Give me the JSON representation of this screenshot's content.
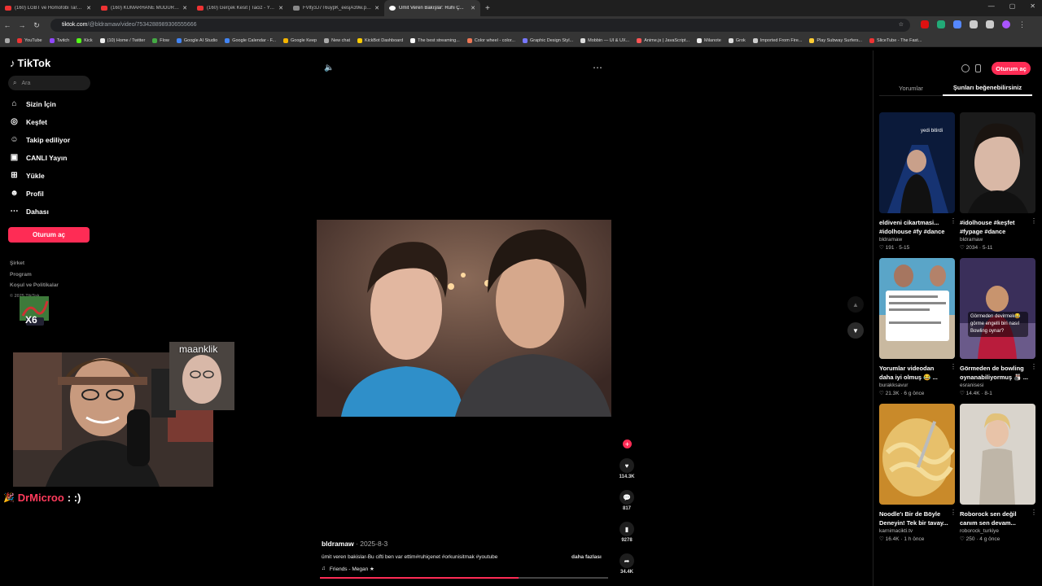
{
  "browser": {
    "tabs": [
      {
        "title": "(160) LGBT ve Homofobi Tartış...",
        "favicon": "youtube-icon"
      },
      {
        "title": "(160) KUMARHANE MÜDÜRÜ...",
        "favicon": "youtube-icon"
      },
      {
        "title": "(160) Gerçek Kesit | Taciz - You...",
        "favicon": "youtube-icon"
      },
      {
        "title": "FVlty3J7T6uypK_eesjA39w.png",
        "favicon": "image-icon"
      },
      {
        "title": "Ümit Veren Bakışlar: Ruhi Ç...",
        "favicon": "tiktok-icon",
        "active": true
      }
    ],
    "new_tab": "+",
    "url_host": "tiktok.com",
    "url_path": "/@bldramaw/video/7534288989306555666",
    "bookmarks": [
      "YouTube",
      "Twitch",
      "Kick",
      "(10) Home / Twitter",
      "Flow",
      "Google AI Studio",
      "Google Calendar - F...",
      "Google Keep",
      "New chat",
      "KickBot Dashboard",
      "The best streaming...",
      "Color wheel - color...",
      "Graphic Design Styl...",
      "Mobbin — UI & UX...",
      "Anime.js | JavaScript...",
      "Milanote",
      "Grok",
      "Imported From Fire...",
      "Play Subway Surfers...",
      "SliceTube - The Fast..."
    ]
  },
  "sidebar": {
    "logo": "TikTok",
    "search_placeholder": "Ara",
    "items": [
      {
        "label": "Sizin İçin",
        "icon": "home-icon"
      },
      {
        "label": "Keşfet",
        "icon": "compass-icon"
      },
      {
        "label": "Takip ediliyor",
        "icon": "user-follow-icon"
      },
      {
        "label": "CANLI Yayın",
        "icon": "live-icon"
      },
      {
        "label": "Yükle",
        "icon": "upload-icon"
      },
      {
        "label": "Profil",
        "icon": "profile-icon"
      },
      {
        "label": "Dahası",
        "icon": "more-icon"
      }
    ],
    "login": "Oturum aç",
    "footer": [
      "Şirket",
      "Program",
      "Koşul ve Politikalar",
      "© 2025 TikTok"
    ]
  },
  "stream": {
    "cam_name": "maanklik",
    "chat_user": "DrMicroo",
    "chat_msg": ": :)",
    "badge_text": "X6"
  },
  "video": {
    "author": "bldramaw",
    "date": "· 2025-8-3",
    "caption": "ümit veren bakislar-Bu cifti ben var ettim#ruhiçenet #orkunisitmak #youtube",
    "more": "daha fazlası",
    "music": "Friends - Megan ★",
    "progress": 0.69,
    "likes": "114.3K",
    "comments": "817",
    "saves": "9278",
    "shares": "34.4K"
  },
  "right_panel": {
    "login": "Oturum aç",
    "tabs": [
      "Yorumlar",
      "Şunları beğenebilirsiniz"
    ],
    "cards": [
      {
        "title": "eldiveni cikartmasi... #idolhouse #fy #dance",
        "user": "bldramaw",
        "likes": "191",
        "age": "5-15",
        "overlay": "yedi bitirdi"
      },
      {
        "title": "#idolhouse #keşfet #fypage #dance",
        "user": "bldramaw",
        "likes": "2034",
        "age": "5-11",
        "overlay": ""
      },
      {
        "title": "Yorumlar videodan daha iyi olmuş 😂 ...",
        "user": "burakksavur",
        "likes": "21.3K",
        "age": "6 g önce",
        "overlay": ""
      },
      {
        "title": "Görmeden de bowling oynanabiliyormuş 🎳 ...",
        "user": "esranisesi",
        "likes": "14.4K",
        "age": "8-1",
        "overlay": "Görmeden devirmek😂 görme engelli biri nasıl Bowling oynar?"
      },
      {
        "title": "Noodle'ı Bir de Böyle Deneyin! Tek bir tavay...",
        "user": "karnimacikti.tv",
        "likes": "16.4K",
        "age": "1 h önce",
        "overlay": ""
      },
      {
        "title": "Roborock sen değil canım sen devam...",
        "user": "roborock_turkiye",
        "likes": "250",
        "age": "4 g önce",
        "overlay": ""
      }
    ]
  }
}
